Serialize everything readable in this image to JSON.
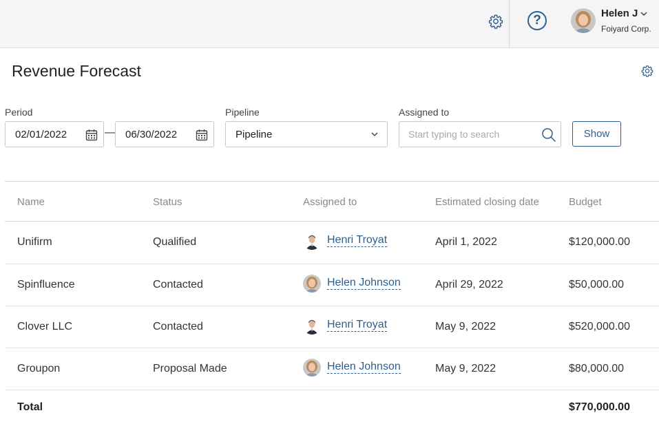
{
  "header": {
    "user_name": "Helen J",
    "company": "Foiyard Corp."
  },
  "page": {
    "title": "Revenue Forecast"
  },
  "filters": {
    "period_label": "Period",
    "date_from": "02/01/2022",
    "date_separator": "—",
    "date_to": "06/30/2022",
    "pipeline_label": "Pipeline",
    "pipeline_value": "Pipeline",
    "assigned_label": "Assigned to",
    "assigned_placeholder": "Start typing to search",
    "show_label": "Show"
  },
  "table": {
    "columns": [
      "Name",
      "Status",
      "Assigned to",
      "Estimated closing date",
      "Budget"
    ],
    "rows": [
      {
        "name": "Unifirm",
        "status": "Qualified",
        "assigned": "Henri Troyat",
        "avatar": "male",
        "date": "April 1, 2022",
        "budget": "$120,000.00"
      },
      {
        "name": "Spinfluence",
        "status": "Contacted",
        "assigned": "Helen Johnson",
        "avatar": "female",
        "date": "April 29, 2022",
        "budget": "$50,000.00"
      },
      {
        "name": "Clover LLC",
        "status": "Contacted",
        "assigned": "Henri Troyat",
        "avatar": "male",
        "date": "May 9, 2022",
        "budget": "$520,000.00"
      },
      {
        "name": "Groupon",
        "status": "Proposal Made",
        "assigned": "Helen Johnson",
        "avatar": "female",
        "date": "May 9, 2022",
        "budget": "$80,000.00"
      }
    ],
    "total_label": "Total",
    "total_value": "$770,000.00"
  },
  "icons": {
    "top_settings": "gear-icon",
    "help": "question-mark-icon",
    "user_menu": "chevron-down-icon",
    "page_settings": "gear-icon",
    "calendar": "calendar-icon",
    "select": "chevron-down-icon",
    "search": "search-icon"
  },
  "colors": {
    "accent": "#2c5e8e",
    "topbar_bg": "#f5f5f5",
    "header_text": "#8a8a8a"
  }
}
